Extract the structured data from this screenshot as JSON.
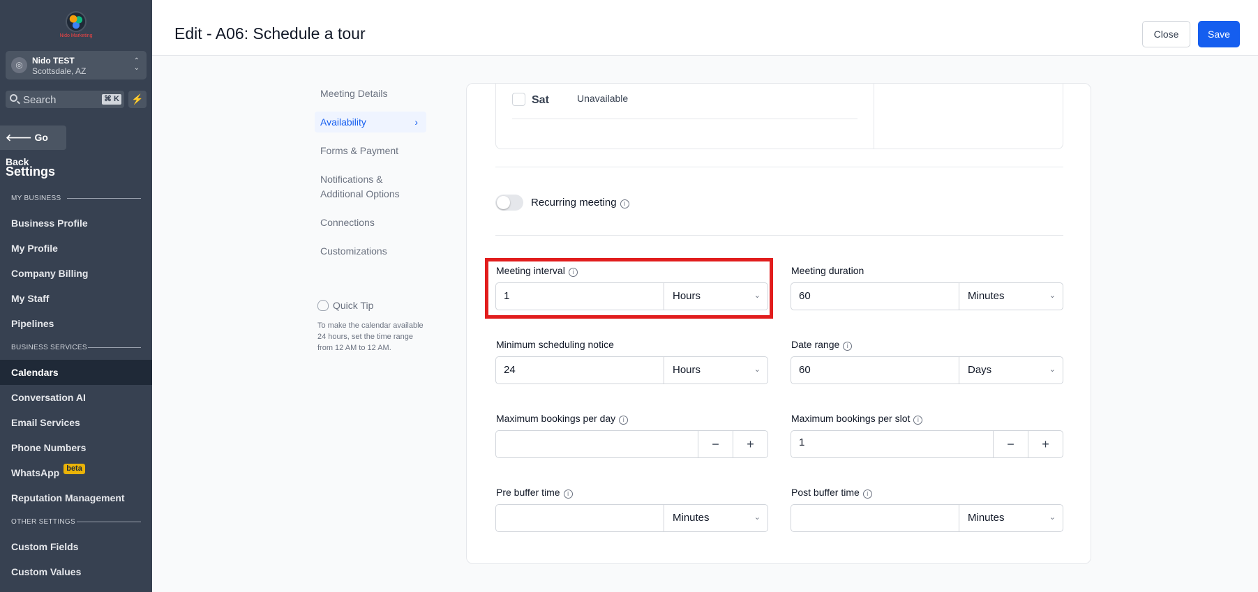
{
  "sidebar": {
    "logo_text": "Nido Marketing",
    "account": {
      "name": "Nido TEST",
      "location": "Scottsdale, AZ"
    },
    "search": {
      "placeholder": "Search",
      "shortcut": "⌘ K"
    },
    "go_back": "Go Back",
    "title": "Settings",
    "sections": [
      {
        "label": "MY BUSINESS"
      },
      {
        "label": "BUSINESS SERVICES"
      },
      {
        "label": "OTHER SETTINGS"
      }
    ],
    "items": [
      {
        "label": "Business Profile"
      },
      {
        "label": "My Profile"
      },
      {
        "label": "Company Billing"
      },
      {
        "label": "My Staff"
      },
      {
        "label": "Pipelines"
      },
      {
        "label": "Calendars"
      },
      {
        "label": "Conversation AI"
      },
      {
        "label": "Email Services"
      },
      {
        "label": "Phone Numbers"
      },
      {
        "label": "WhatsApp",
        "badge": "beta"
      },
      {
        "label": "Reputation Management"
      },
      {
        "label": "Custom Fields"
      },
      {
        "label": "Custom Values"
      }
    ],
    "active_item": "Calendars"
  },
  "header": {
    "title": "Edit - A06: Schedule a tour",
    "close_label": "Close",
    "save_label": "Save"
  },
  "menu": {
    "items": [
      {
        "label": "Meeting Details"
      },
      {
        "label": "Availability"
      },
      {
        "label": "Forms & Payment"
      },
      {
        "label": "Notifications & Additional Options"
      },
      {
        "label": "Connections"
      },
      {
        "label": "Customizations"
      }
    ],
    "active_item": "Availability"
  },
  "quick_tip": {
    "title": "Quick Tip",
    "text": "To make the calendar available 24 hours, set the time range from 12 AM to 12 AM."
  },
  "availability": {
    "sat": {
      "day": "Sat",
      "status": "Unavailable",
      "checked": false
    },
    "recurring": {
      "label": "Recurring meeting",
      "enabled": false
    },
    "meeting_interval": {
      "label": "Meeting interval",
      "value": "1",
      "unit": "Hours"
    },
    "meeting_duration": {
      "label": "Meeting duration",
      "value": "60",
      "unit": "Minutes"
    },
    "min_notice": {
      "label": "Minimum scheduling notice",
      "value": "24",
      "unit": "Hours"
    },
    "date_range": {
      "label": "Date range",
      "value": "60",
      "unit": "Days"
    },
    "max_per_day": {
      "label": "Maximum bookings per day",
      "value": ""
    },
    "max_per_slot": {
      "label": "Maximum bookings per slot",
      "value": "1"
    },
    "pre_buffer": {
      "label": "Pre buffer time",
      "value": "",
      "unit": "Minutes"
    },
    "post_buffer": {
      "label": "Post buffer time",
      "value": "",
      "unit": "Minutes"
    }
  },
  "colors": {
    "sidebar_bg": "#374151",
    "primary": "#155eef",
    "highlight": "#e11d1d"
  }
}
